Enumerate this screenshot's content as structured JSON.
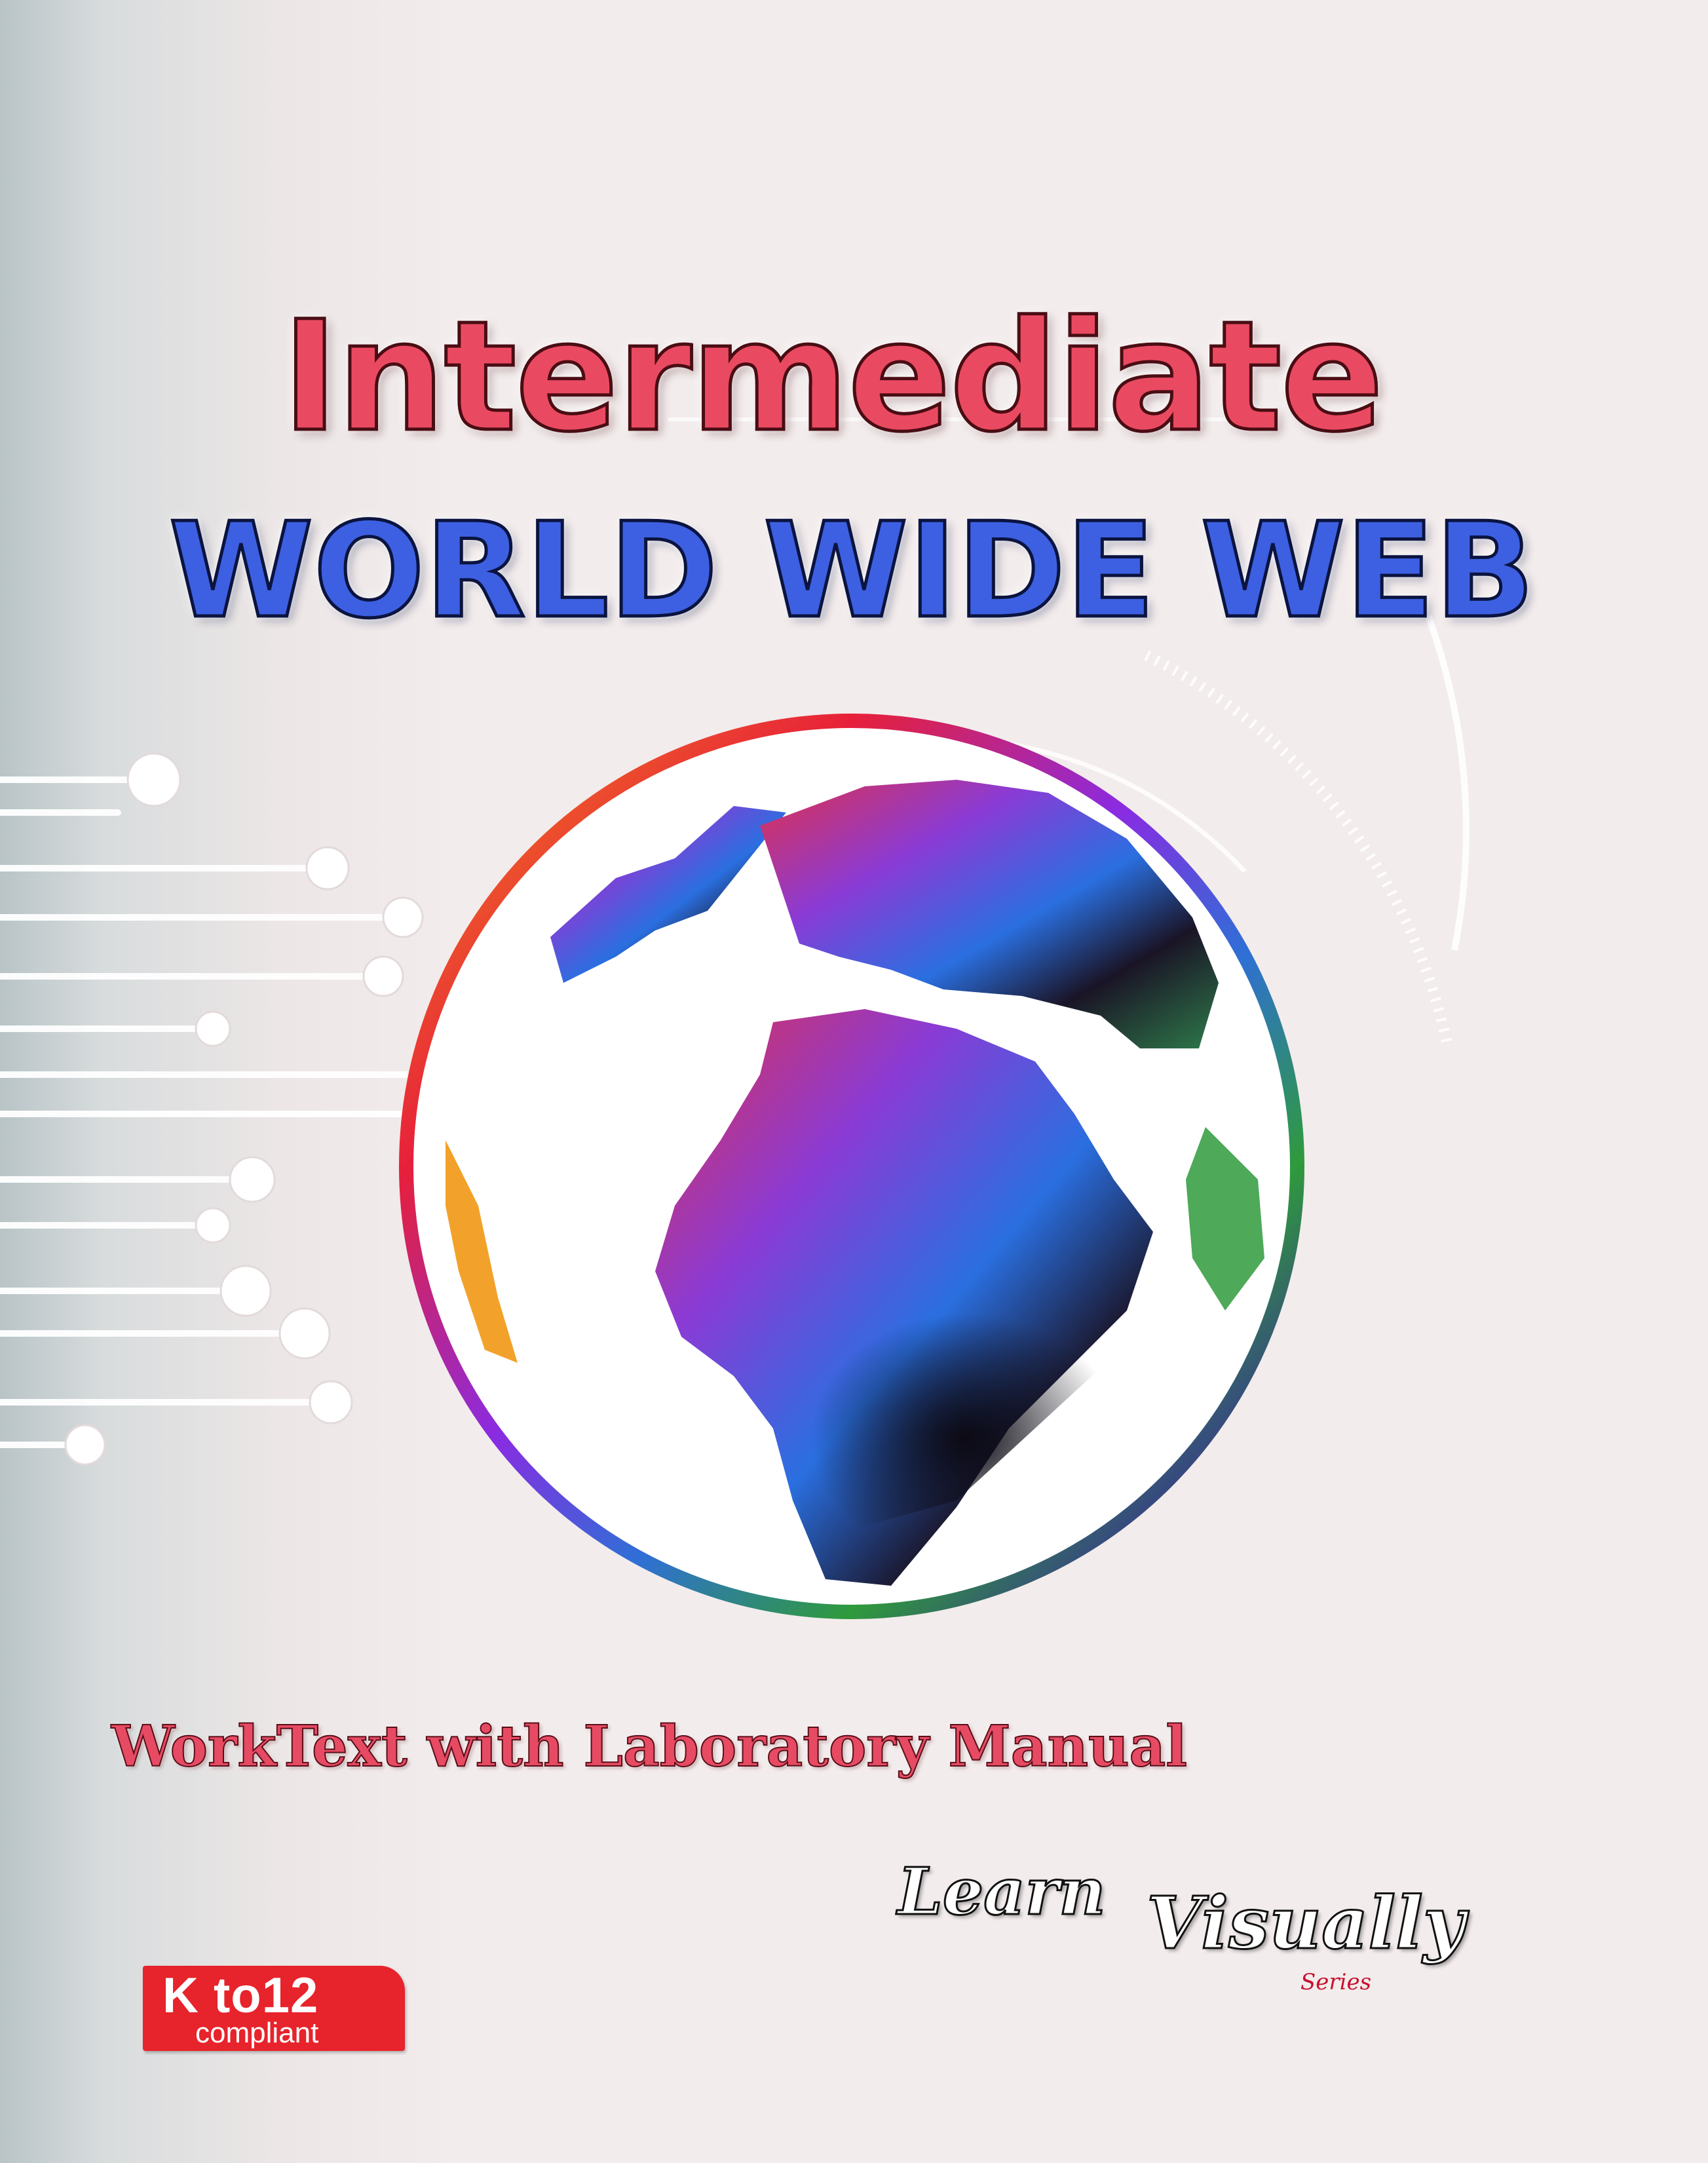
{
  "cover": {
    "title_line1": "Intermediate",
    "title_line2": "WORLD WIDE WEB",
    "subtitle": "WorkText with Laboratory Manual",
    "badge_main": "K to12",
    "badge_sub": "compliant",
    "series_word1": "Learn",
    "series_word2": "Visually",
    "series_label": "Series"
  },
  "colors": {
    "title_line1": "#ea4a61",
    "title_line2": "#3d60e2",
    "subtitle": "#e64b63",
    "badge": "#e7232b",
    "background": "#f3ecec"
  },
  "icons": [
    "globe-icon",
    "circuit-lines-decoration"
  ]
}
